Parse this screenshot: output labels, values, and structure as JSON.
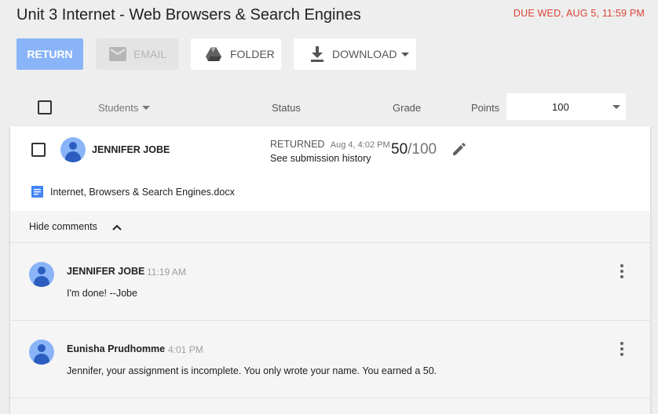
{
  "header": {
    "title": "Unit 3 Internet - Web Browsers & Search Engines",
    "due": "DUE WED, AUG 5, 11:59 PM"
  },
  "toolbar": {
    "return_label": "RETURN",
    "email_label": "EMAIL",
    "folder_label": "FOLDER",
    "download_label": "DOWNLOAD"
  },
  "columns": {
    "students": "Students",
    "status": "Status",
    "grade": "Grade",
    "points": "Points",
    "points_value": "100"
  },
  "submission": {
    "student_name": "JENNIFER JOBE",
    "status": "RETURNED",
    "status_time": "Aug 4, 4:02 PM",
    "history_link": "See submission history",
    "grade": "50",
    "grade_total": "/100",
    "attachment": "Internet, Browsers & Search Engines.docx",
    "hide_comments": "Hide comments"
  },
  "comments": [
    {
      "author": "JENNIFER JOBE",
      "time": "11:19 AM",
      "text": "I'm done! --Jobe"
    },
    {
      "author": "Eunisha Prudhomme",
      "time": "4:01 PM",
      "text": "Jennifer, your assignment is incomplete. You only wrote your name. You earned a 50."
    }
  ],
  "colors": {
    "accent": "#8ab4f8",
    "due": "#db4437",
    "doc_icon": "#4285f4"
  },
  "icons": {
    "email": "mail-icon",
    "folder": "drive-icon",
    "download": "download-icon",
    "edit": "pencil-icon",
    "doc": "docs-icon",
    "chevron": "chevron-up-icon",
    "more": "more-vert-icon"
  }
}
